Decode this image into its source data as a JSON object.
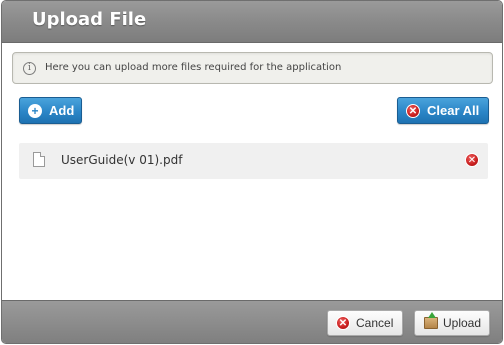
{
  "dialog": {
    "title": "Upload File",
    "info": {
      "icon": "info-icon",
      "text": "Here you can upload more files required for the application"
    },
    "toolbar": {
      "add_label": "Add",
      "clear_all_label": "Clear All"
    },
    "files": [
      {
        "name": "UserGuide(v 01).pdf",
        "icon": "document-icon",
        "remove_icon": "remove-icon"
      }
    ],
    "footer": {
      "cancel_label": "Cancel",
      "upload_label": "Upload"
    }
  },
  "colors": {
    "titlebar": "#8a8a8a",
    "primary_button": "#2b86c7",
    "remove_red": "#c81e1e"
  }
}
